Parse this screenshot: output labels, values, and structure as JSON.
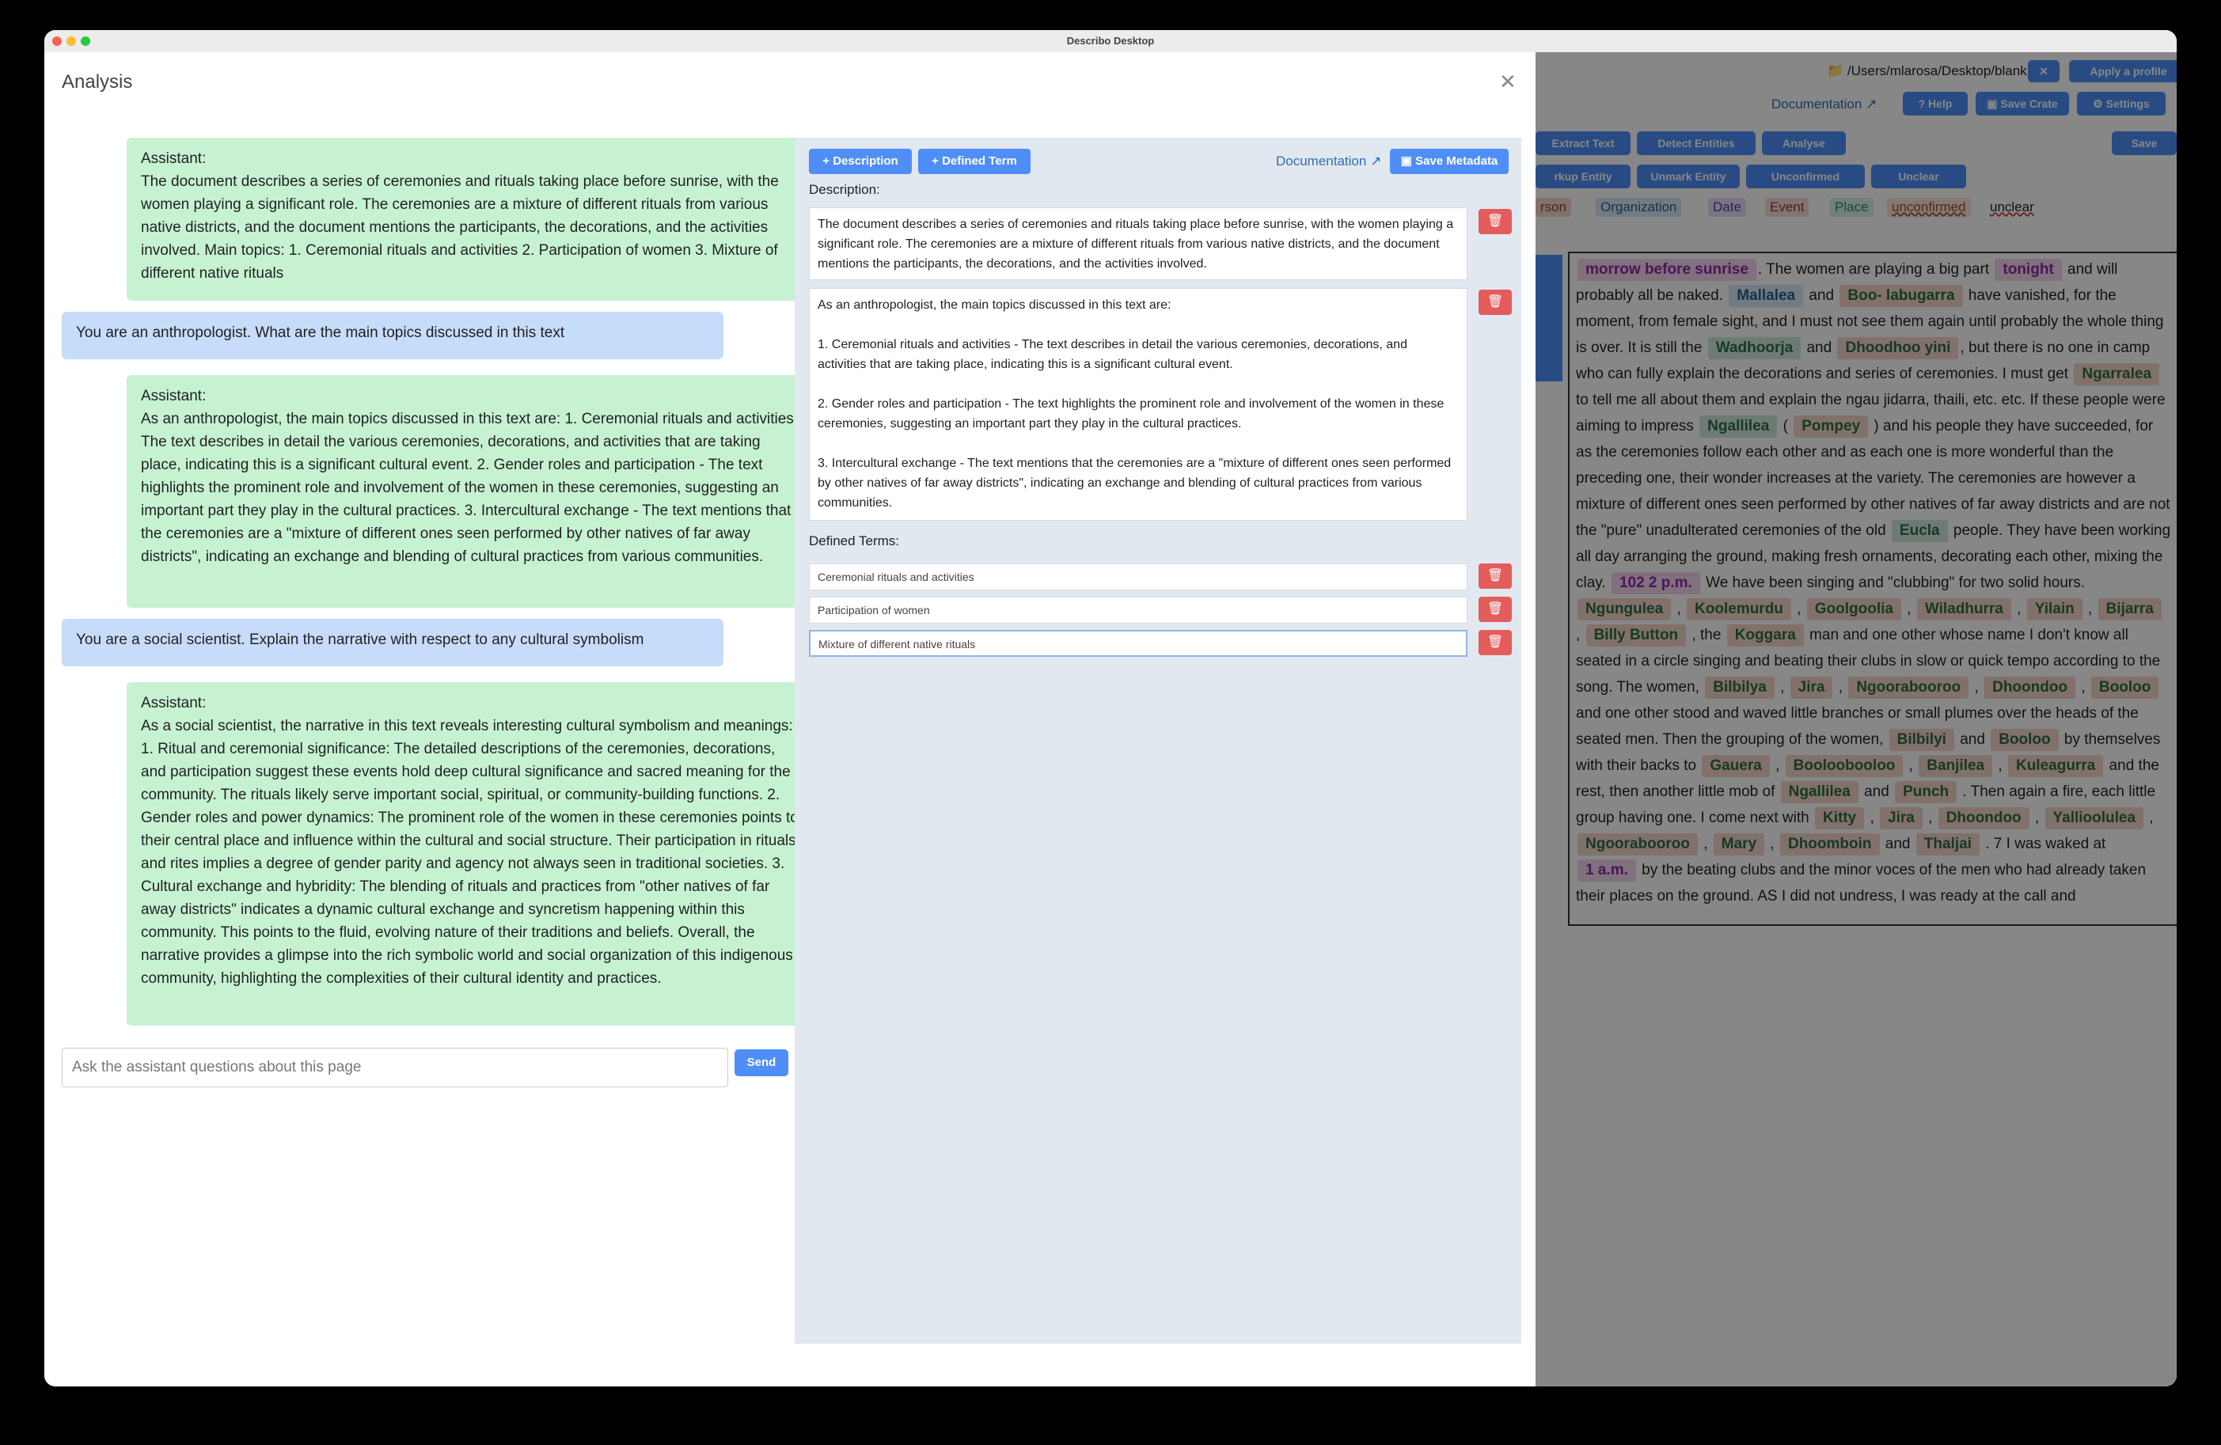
{
  "window": {
    "title": "Describo Desktop"
  },
  "background": {
    "path": "/Users/mlarosa/Desktop/blank crate",
    "apply_profile": "Apply a profile",
    "documentation": "Documentation",
    "help": "Help",
    "save_crate": "Save Crate",
    "settings": "Settings",
    "toolbar": [
      "Extract Text",
      "Detect Entities",
      "Analyse"
    ],
    "save": "Save",
    "toolbar2": [
      "rkup Entity",
      "Unmark Entity",
      "Unconfirmed",
      "Unclear"
    ],
    "legend": [
      "rson",
      "Organization",
      "Date",
      "Event",
      "Place",
      "unconfirmed",
      "unclear"
    ]
  },
  "modal": {
    "title": "Analysis",
    "messages": [
      {
        "role": "assistant",
        "label": "Assistant:",
        "text": "The document describes a series of ceremonies and rituals taking place before sunrise, with the women playing a significant role. The ceremonies are a mixture of different rituals from various native districts, and the document mentions the participants, the decorations, and the activities involved. Main topics: 1. Ceremonial rituals and activities 2. Participation of women 3. Mixture of different native rituals"
      },
      {
        "role": "user",
        "text": "You are an anthropologist. What are the main topics discussed in this text"
      },
      {
        "role": "assistant",
        "label": "Assistant:",
        "text": "As an anthropologist, the main topics discussed in this text are: 1. Ceremonial rituals and activities - The text describes in detail the various ceremonies, decorations, and activities that are taking place, indicating this is a significant cultural event. 2. Gender roles and participation - The text highlights the prominent role and involvement of the women in these ceremonies, suggesting an important part they play in the cultural practices. 3. Intercultural exchange - The text mentions that the ceremonies are a \"mixture of different ones seen performed by other natives of far away districts\", indicating an exchange and blending of cultural practices from various communities."
      },
      {
        "role": "user",
        "text": "You are a social scientist. Explain the narrative with respect to any cultural symbolism"
      },
      {
        "role": "assistant",
        "label": "Assistant:",
        "text": "As a social scientist, the narrative in this text reveals interesting cultural symbolism and meanings: 1. Ritual and ceremonial significance: The detailed descriptions of the ceremonies, decorations, and participation suggest these events hold deep cultural significance and sacred meaning for the community. The rituals likely serve important social, spiritual, or community-building functions. 2. Gender roles and power dynamics: The prominent role of the women in these ceremonies points to their central place and influence within the cultural and social structure. Their participation in rituals and rites implies a degree of gender parity and agency not always seen in traditional societies. 3. Cultural exchange and hybridity: The blending of rituals and practices from \"other natives of far away districts\" indicates a dynamic cultural exchange and syncretism happening within this community. This points to the fluid, evolving nature of their traditions and beliefs. Overall, the narrative provides a glimpse into the rich symbolic world and social organization of this indigenous community, highlighting the complexities of their cultural identity and practices."
      }
    ],
    "ask_placeholder": "Ask the assistant questions about this page",
    "send": "Send",
    "panel": {
      "add_description": "Description",
      "add_defined_term": "Defined Term",
      "documentation": "Documentation",
      "save_metadata": "Save Metadata",
      "description_label": "Description:",
      "descriptions": [
        "The document describes a series of ceremonies and rituals taking place before sunrise, with the women playing a significant role. The ceremonies are a mixture of different rituals from various native districts, and the document mentions the participants, the decorations, and the activities involved.",
        "As an anthropologist, the main topics discussed in this text are:\n\n1. Ceremonial rituals and activities - The text describes in detail the various ceremonies, decorations, and activities that are taking place, indicating this is a significant cultural event.\n\n2. Gender roles and participation - The text highlights the prominent role and involvement of the women in these ceremonies, suggesting an important part they play in the cultural practices.\n\n3. Intercultural exchange - The text mentions that the ceremonies are a \"mixture of different ones seen performed by other natives of far away districts\", indicating an exchange and blending of cultural practices from various communities."
      ],
      "defined_terms_label": "Defined Terms:",
      "defined_terms": [
        "Ceremonial rituals and activities",
        "Participation of women",
        "Mixture of different native rituals"
      ]
    }
  },
  "document_text": {
    "segments": [
      {
        "t": "morrow before sunrise",
        "e": "pu"
      },
      {
        "t": ". The women are playing a big part "
      },
      {
        "t": "tonight",
        "e": "pu"
      },
      {
        "t": " and will probably all be naked. "
      },
      {
        "t": "Mallalea",
        "e": "bl"
      },
      {
        "t": " and "
      },
      {
        "t": "Boo- labugarra",
        "e": "or"
      },
      {
        "t": " have vanished, for the moment, from female sight, and I must not see them again until probably the whole thing is over. It is still the "
      },
      {
        "t": "Wadhoorja",
        "e": "gr"
      },
      {
        "t": " and "
      },
      {
        "t": "Dhoodhoo yini",
        "e": "or"
      },
      {
        "t": ", but there is no one in camp who can fully explain the decorations and series of ceremonies. I must get "
      },
      {
        "t": "Ngarralea",
        "e": "or"
      },
      {
        "t": " to tell me all about them and explain the ngau jidarra, thaili, etc. etc. If these people were aiming to impress "
      },
      {
        "t": "Ngallilea",
        "e": "gr"
      },
      {
        "t": " ( "
      },
      {
        "t": "Pompey",
        "e": "or"
      },
      {
        "t": " ) and his people they have succeeded, for as the ceremonies follow each other and as each one is more wonderful than the preceding one, their wonder increases at the variety. The ceremonies are however a mixture of different ones seen performed by other natives of far away districts and are not the \"pure\" unadulterated ceremonies of the old "
      },
      {
        "t": "Eucla",
        "e": "gr"
      },
      {
        "t": " people. They have been working all day arranging the ground, making fresh ornaments, decorating each other, mixing the clay. "
      },
      {
        "t": "102 2 p.m.",
        "e": "pu"
      },
      {
        "t": " We have been singing and \"clubbing\" for two solid hours. "
      },
      {
        "t": "Ngungulea",
        "e": "or"
      },
      {
        "t": " , "
      },
      {
        "t": "Koolemurdu",
        "e": "or"
      },
      {
        "t": " , "
      },
      {
        "t": "Goolgoolia",
        "e": "or"
      },
      {
        "t": " , "
      },
      {
        "t": "Wiladhurra",
        "e": "or"
      },
      {
        "t": " , "
      },
      {
        "t": "Yilain",
        "e": "or"
      },
      {
        "t": " , "
      },
      {
        "t": "Bijarra",
        "e": "or"
      },
      {
        "t": " , "
      },
      {
        "t": "Billy Button",
        "e": "or"
      },
      {
        "t": " , the "
      },
      {
        "t": "Koggara",
        "e": "or"
      },
      {
        "t": " man and one other whose name I don't know all seated in a circle singing and beating their clubs in slow or quick tempo according to the song. The women, "
      },
      {
        "t": "Bilbilya",
        "e": "or"
      },
      {
        "t": " , "
      },
      {
        "t": "Jira",
        "e": "or"
      },
      {
        "t": " , "
      },
      {
        "t": "Ngoorabooroo",
        "e": "or"
      },
      {
        "t": " , "
      },
      {
        "t": "Dhoondoo",
        "e": "or"
      },
      {
        "t": " , "
      },
      {
        "t": "Booloo",
        "e": "or"
      },
      {
        "t": " and one other stood and waved little branches or small plumes over the heads of the seated men. Then the grouping of the women, "
      },
      {
        "t": "Bilbilyi",
        "e": "or"
      },
      {
        "t": " and "
      },
      {
        "t": "Booloo",
        "e": "or"
      },
      {
        "t": " by themselves with their backs to "
      },
      {
        "t": "Gauera",
        "e": "or"
      },
      {
        "t": " , "
      },
      {
        "t": "Booloobooloo",
        "e": "or"
      },
      {
        "t": " , "
      },
      {
        "t": "Banjilea",
        "e": "or"
      },
      {
        "t": " , "
      },
      {
        "t": "Kuleagurra",
        "e": "or"
      },
      {
        "t": " and the rest, then another little mob of "
      },
      {
        "t": "Ngallilea",
        "e": "or"
      },
      {
        "t": " and "
      },
      {
        "t": "Punch",
        "e": "or"
      },
      {
        "t": " . Then again a fire, each little group having one. I come next with "
      },
      {
        "t": "Kitty",
        "e": "or"
      },
      {
        "t": " , "
      },
      {
        "t": "Jira",
        "e": "or"
      },
      {
        "t": " , "
      },
      {
        "t": "Dhoondoo",
        "e": "or"
      },
      {
        "t": " , "
      },
      {
        "t": "Yallioolulea",
        "e": "or"
      },
      {
        "t": " , "
      },
      {
        "t": "Ngoorabooroo",
        "e": "or"
      },
      {
        "t": " , "
      },
      {
        "t": "Mary",
        "e": "or"
      },
      {
        "t": " , "
      },
      {
        "t": "Dhoomboin",
        "e": "or"
      },
      {
        "t": " and "
      },
      {
        "t": "Thaljai",
        "e": "or"
      },
      {
        "t": " . 7 I was waked at "
      },
      {
        "t": "1 a.m.",
        "e": "pu"
      },
      {
        "t": " by the beating clubs and the minor voces of the men who had already taken their places on the ground. AS I did not undress, I was ready at the call and"
      }
    ]
  }
}
